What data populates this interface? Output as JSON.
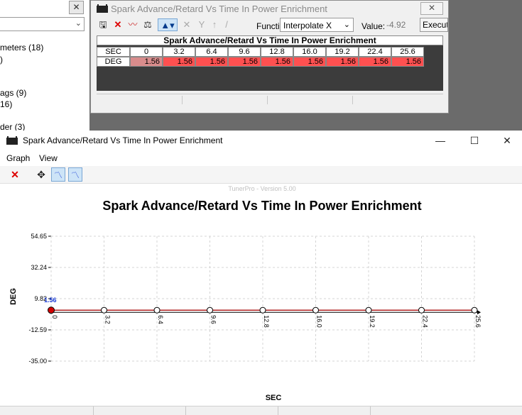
{
  "left_panel": {
    "close_label": "✕",
    "tree_items": [
      "meters (18)",
      ")",
      "ags (9)",
      "16)",
      "der (3)"
    ]
  },
  "table_window": {
    "title": "Spark Advance/Retard Vs Time In Power Enrichment",
    "close_label": "✕",
    "toolbar": {
      "save_icon": "save-icon",
      "delete_icon": "delete-icon",
      "function_label": "Function:",
      "function_value": "Interpolate X",
      "value_label": "Value:",
      "value_value": "-4.92",
      "execute_label": "Execute"
    },
    "grid": {
      "title": "Spark Advance/Retard Vs Time In Power Enrichment",
      "row_header_x": "SEC",
      "row_header_y": "DEG",
      "columns": [
        "0",
        "3.2",
        "6.4",
        "9.6",
        "12.8",
        "16.0",
        "19.2",
        "22.4",
        "25.6"
      ],
      "values": [
        "1.56",
        "1.56",
        "1.56",
        "1.56",
        "1.56",
        "1.56",
        "1.56",
        "1.56",
        "1.56"
      ],
      "cell_color": "#ff5050",
      "selected_cell_color": "#d98c8c"
    }
  },
  "graph_window": {
    "title": "Spark Advance/Retard Vs Time In Power Enrichment",
    "menu": [
      "Graph",
      "View"
    ],
    "watermark": "TunerPro - Version 5.00"
  },
  "chart_data": {
    "type": "line",
    "title": "Spark Advance/Retard Vs Time In Power Enrichment",
    "xlabel": "SEC",
    "ylabel": "DEG",
    "x": [
      0,
      3.2,
      6.4,
      9.6,
      12.8,
      16.0,
      19.2,
      22.4,
      25.6
    ],
    "x_tick_labels": [
      "0",
      "3.2",
      "6.4",
      "9.6",
      "12.8",
      "16.0",
      "19.2",
      "22.4",
      "25.6"
    ],
    "y_ticks": [
      54.65,
      32.24,
      9.82,
      -12.59,
      -35.0
    ],
    "y_tick_labels": [
      "54.65",
      "32.24",
      "9.82",
      "-12.59",
      "-35.00"
    ],
    "ylim": [
      -35.0,
      54.65
    ],
    "xlim": [
      0,
      25.6
    ],
    "grid": true,
    "series": [
      {
        "values": [
          1.56,
          1.56,
          1.56,
          1.56,
          1.56,
          1.56,
          1.56,
          1.56,
          1.56
        ],
        "color": "#b22222"
      }
    ],
    "highlight_label": "1.56"
  }
}
